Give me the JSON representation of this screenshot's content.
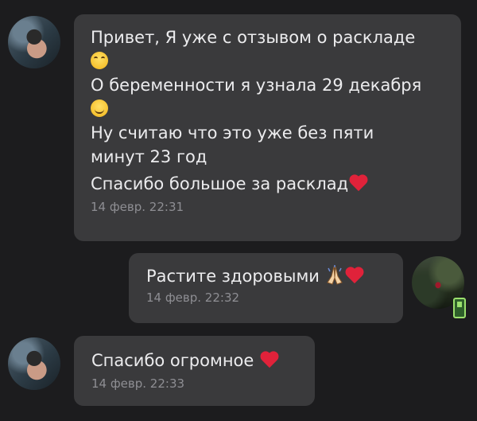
{
  "messages": [
    {
      "lines": [
        "Привет, Я уже с отзывом о раскладе",
        "О беременности я узнала 29 декабря",
        "Ну считаю что это уже без пяти",
        "минут 23 год",
        "Спасибо большое за расклад"
      ],
      "time": "14 февр. 22:31"
    },
    {
      "text": "Растите здоровыми",
      "time": "14 февр. 22:32"
    },
    {
      "text": "Спасибо огромное",
      "time": "14 февр. 22:33"
    }
  ],
  "icons": {
    "laugh": "grinning-squinting-face-icon",
    "smile": "smiling-face-icon",
    "heart": "red-heart-icon",
    "pray": "folded-hands-icon",
    "phone": "mobile-phone-icon"
  },
  "colors": {
    "background": "#1c1c1e",
    "bubble": "#3a3a3c",
    "text": "#ececee",
    "timestamp": "#8e8e93",
    "heart": "#e0223a"
  }
}
